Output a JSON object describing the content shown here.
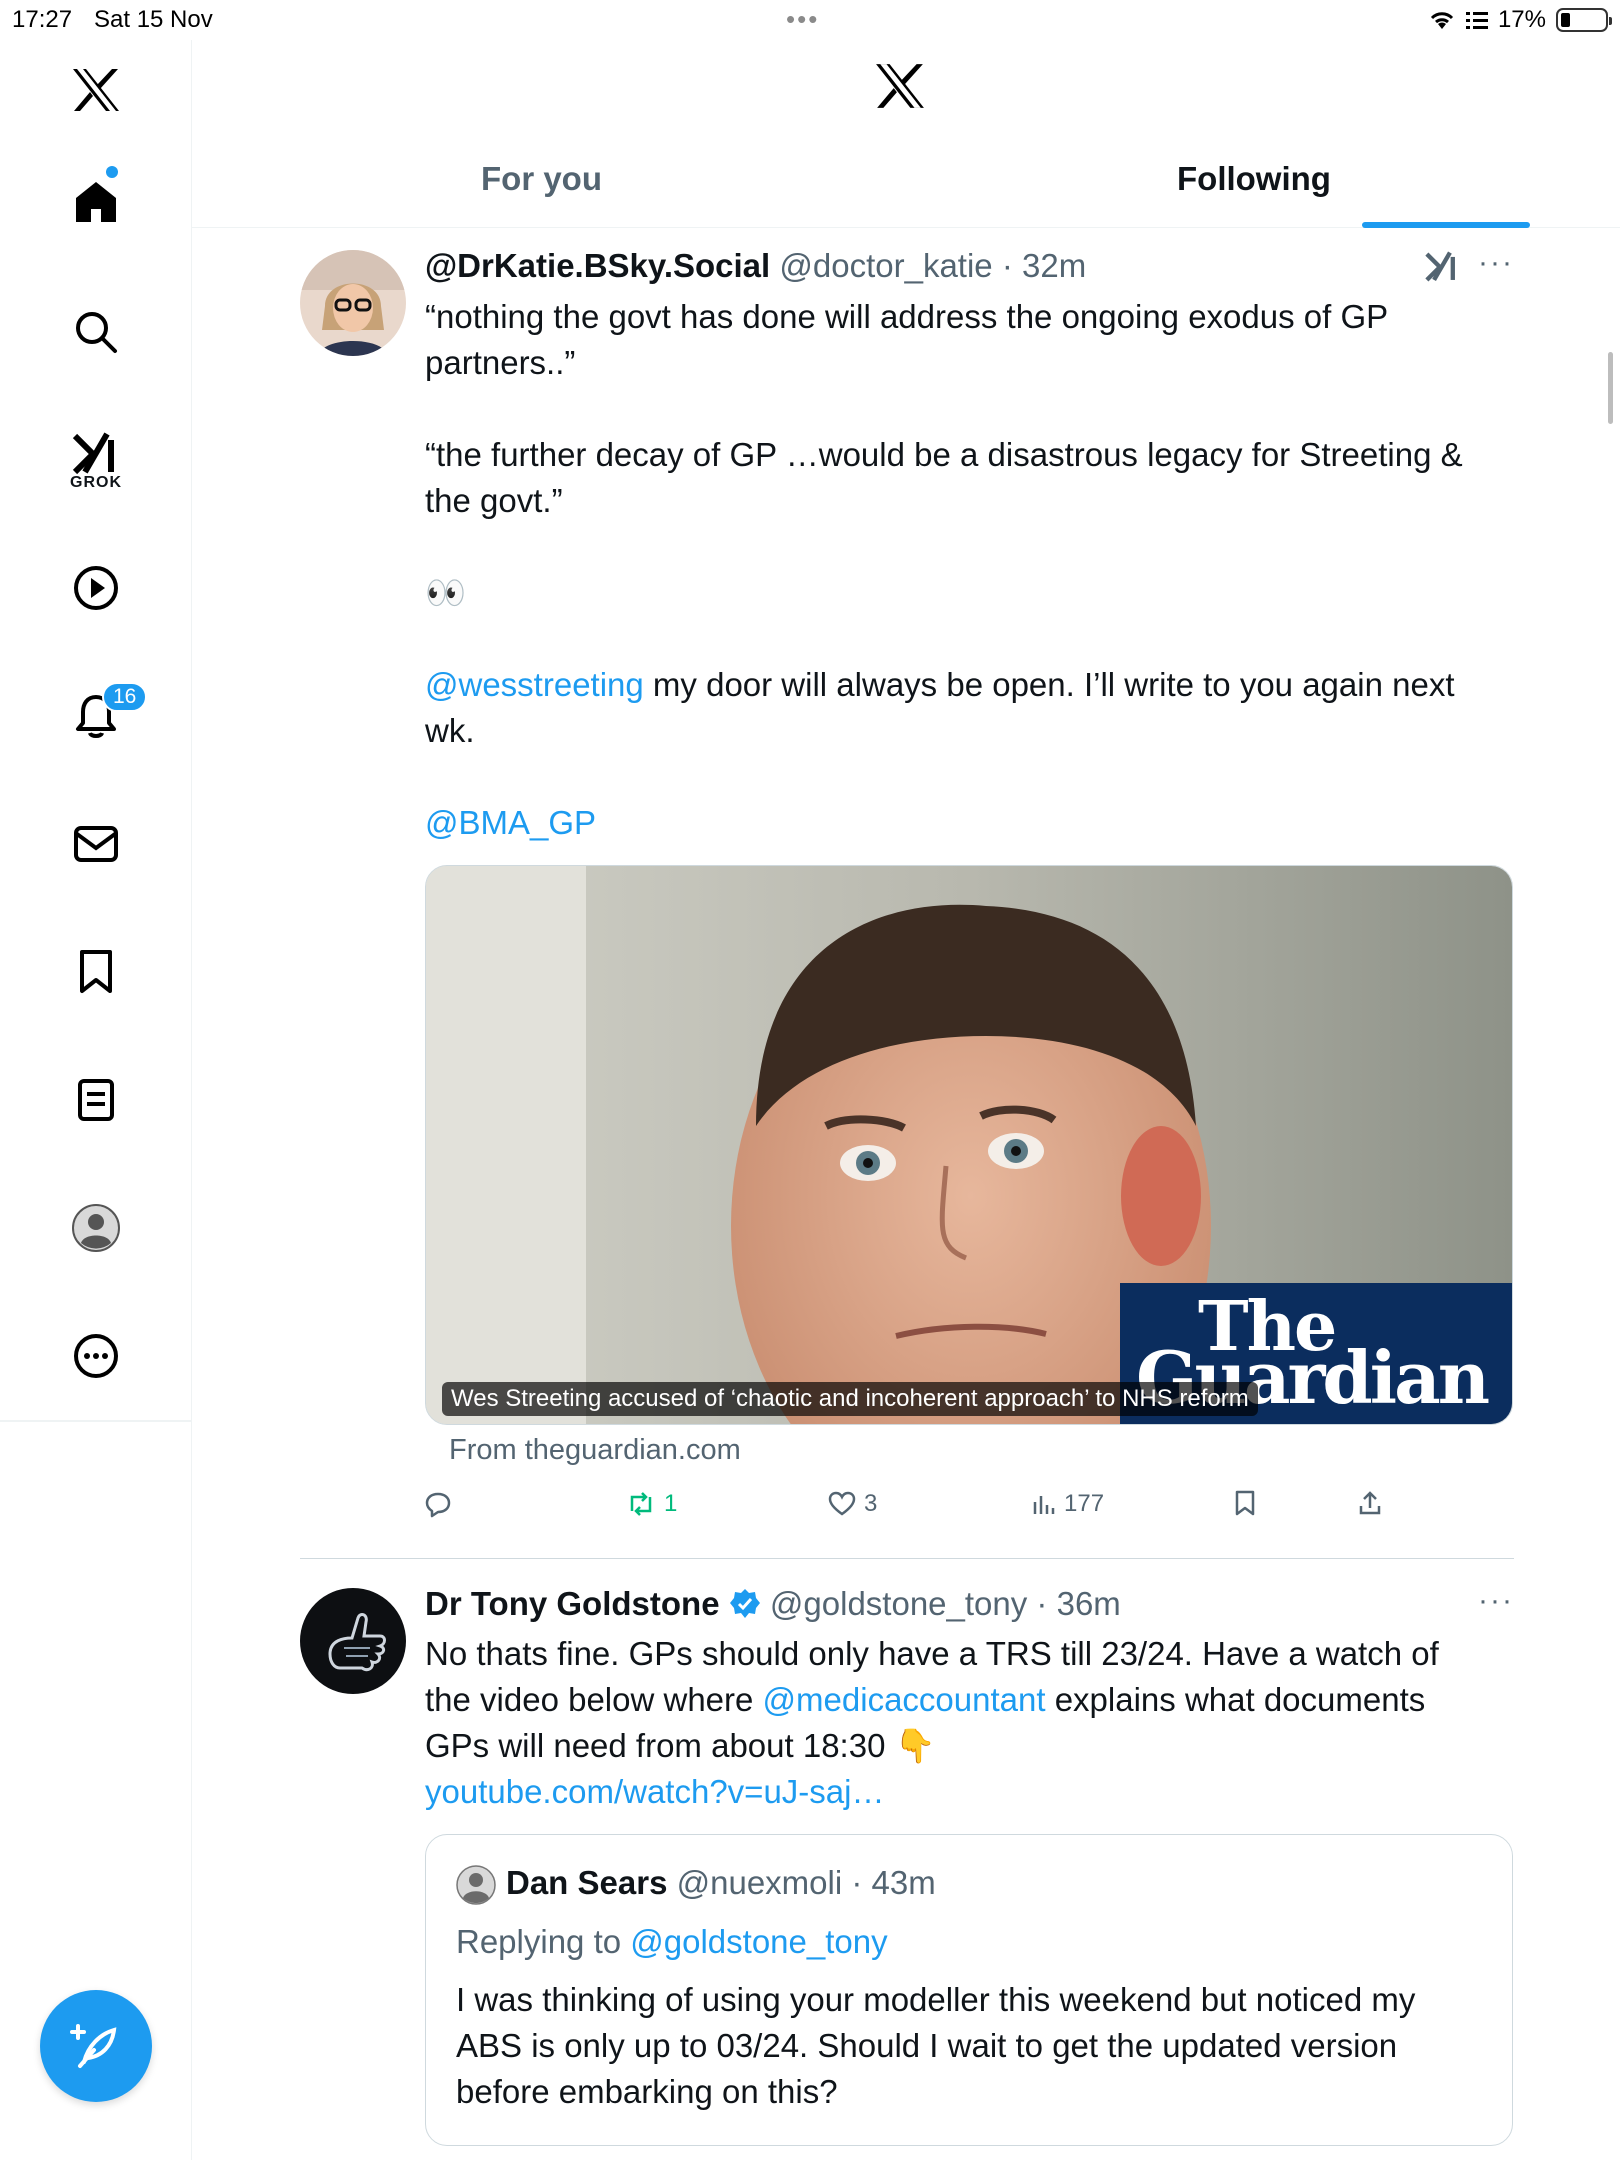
{
  "status_bar": {
    "time": "17:27",
    "date": "Sat 15 Nov",
    "battery": "17%"
  },
  "sidebar": {
    "items": [
      {
        "name": "home"
      },
      {
        "name": "search"
      },
      {
        "name": "grok",
        "label": "GROK"
      },
      {
        "name": "video"
      },
      {
        "name": "notifications",
        "badge": "16"
      },
      {
        "name": "messages"
      },
      {
        "name": "bookmarks"
      },
      {
        "name": "articles"
      },
      {
        "name": "profile"
      },
      {
        "name": "more"
      }
    ]
  },
  "header": {
    "tabs": [
      {
        "label": "For you"
      },
      {
        "label": "Following"
      }
    ],
    "active_tab": "Following"
  },
  "tweets": [
    {
      "display_name": "@DrKatie.BSky.Social",
      "handle": "@doctor_katie",
      "time": "32m",
      "lines": [
        "“nothing the govt has done will address the ongoing exodus of GP",
        "partners..”",
        "“the further decay of GP …would be a disastrous legacy for Streeting &",
        "the govt.”",
        "👀"
      ],
      "mention1": "@wesstreeting",
      "mention1_text": " my door will always be open. I’ll write to you again next",
      "mention1_text2": "wk.",
      "mention2": "@BMA_GP",
      "card": {
        "caption": "Wes Streeting accused of ‘chaotic and incoherent approach’ to NHS reform",
        "brand_line1": "The",
        "brand_line2": "Guardian",
        "source": "From theguardian.com"
      },
      "stats": {
        "replies": "",
        "reposts": "1",
        "likes": "3",
        "views": "177"
      }
    },
    {
      "display_name": "Dr Tony Goldstone",
      "handle": "@goldstone_tony",
      "time": "36m",
      "line1": "No thats fine. GPs should only have a TRS till 23/24. Have a watch of",
      "line2_a": "the video below where ",
      "line2_mention": "@medicaccountant",
      "line2_b": " explains what documents",
      "line3": "GPs will need from about 18:30 👇",
      "link": "youtube.com/watch?v=uJ-saj…",
      "quote": {
        "display_name": "Dan Sears",
        "handle": "@nuexmoli",
        "time": "43m",
        "replying_prefix": "Replying to ",
        "replying_to": "@goldstone_tony",
        "lines": [
          "I was thinking of using your modeller this weekend but noticed my",
          "ABS is only up to 03/24. Should I wait to get the updated version",
          "before embarking on this?"
        ]
      }
    }
  ],
  "colors": {
    "accent": "#1d9bf0",
    "repost_green": "#00ba7c",
    "guardian_blue": "#0b2d5e"
  }
}
